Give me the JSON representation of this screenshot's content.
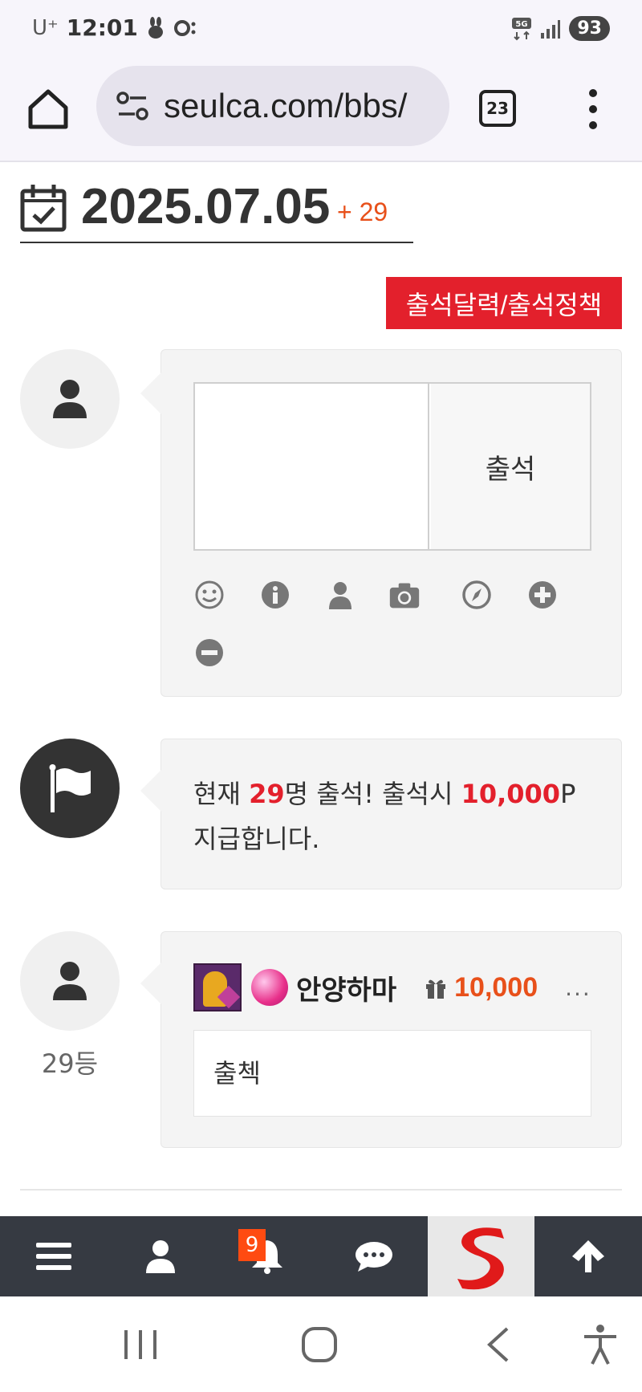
{
  "status_bar": {
    "carrier": "U⁺",
    "time": "12:01",
    "network": "5G",
    "battery": "93"
  },
  "browser": {
    "url": "seulca.com/bbs/",
    "tab_count": "23"
  },
  "header": {
    "date": "2025.07.05",
    "count": "+ 29"
  },
  "policy_button": "출석달력/출석정책",
  "attendance_form": {
    "textarea_placeholder": "",
    "submit_label": "출석",
    "tools": [
      "smile-icon",
      "info-icon",
      "user-icon",
      "camera-icon",
      "compass-icon",
      "plus-circle-icon",
      "minus-circle-icon"
    ]
  },
  "notice": {
    "prefix": "현재 ",
    "count": "29",
    "middle": "명 출석! 출석시 ",
    "points": "10,000",
    "suffix": "P 지급합니다."
  },
  "entry": {
    "nickname": "안양하마",
    "points": "10,000",
    "more": "...",
    "comment": "출첵",
    "rank": "29등"
  },
  "bottom_nav": {
    "notification_count": "9"
  },
  "colors": {
    "accent_red": "#e3202c",
    "accent_orange": "#e8501a",
    "nav_bg": "#363a42"
  }
}
